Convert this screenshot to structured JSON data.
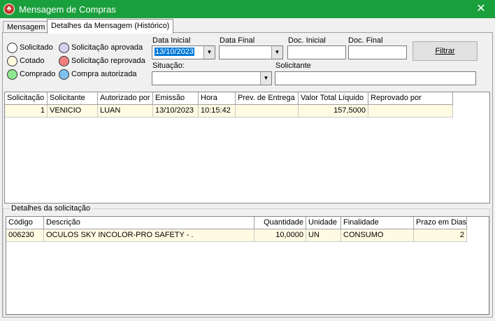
{
  "window": {
    "title": "Mensagem de Compras",
    "icon": "app-logo-icon",
    "close_glyph": "✕",
    "titlebar_color": "#1a9f3d"
  },
  "tabs": [
    {
      "label": "Mensagem"
    },
    {
      "label": "Detalhes da Mensagem (Histórico)"
    }
  ],
  "legend": [
    {
      "label": "Solicitado",
      "color": "#ffffff"
    },
    {
      "label": "Cotado",
      "color": "#fffbe0"
    },
    {
      "label": "Comprado",
      "color": "#90e890"
    },
    {
      "label": "Solicitação aprovada",
      "color": "#d8d0f0"
    },
    {
      "label": "Solicitação reprovada",
      "color": "#f08080"
    },
    {
      "label": "Compra autorizada",
      "color": "#80c0f0"
    }
  ],
  "filters": {
    "data_inicial_label": "Data Inicial",
    "data_inicial_value": "13/10/2023",
    "data_final_label": "Data Final",
    "data_final_value": "",
    "doc_inicial_label": "Doc. Inicial",
    "doc_inicial_value": "",
    "doc_final_label": "Doc. Final",
    "doc_final_value": "",
    "situacao_label": "Situação:",
    "situacao_value": "",
    "solicitante_label": "Solicitante",
    "solicitante_value": "",
    "filtrar_label": "Filtrar",
    "combo_arrow": "▼"
  },
  "main_grid": {
    "columns": [
      "Solicitação",
      "Solicitante",
      "Autorizado por",
      "Emissão",
      "Hora",
      "Prev. de Entrega",
      "Valor Total Líquido",
      "Reprovado por"
    ],
    "rows": [
      [
        "1",
        "VENICIO",
        "LUAN",
        "13/10/2023",
        "10:15:42",
        "",
        "157,5000",
        ""
      ]
    ]
  },
  "details": {
    "group_label": "Detalhes da solicitação",
    "columns": [
      "Código",
      "Descrição",
      "Quantidade",
      "Unidade",
      "Finalidade",
      "Prazo em Dias"
    ],
    "rows": [
      [
        "006230",
        "OCULOS SKY INCOLOR-PRO SAFETY - .",
        "10,0000",
        "UN",
        "CONSUMO",
        "2"
      ]
    ]
  }
}
